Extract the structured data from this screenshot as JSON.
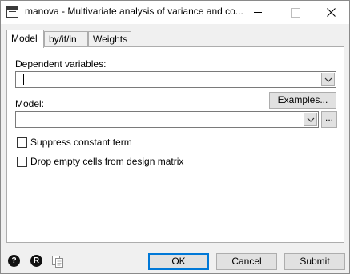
{
  "window": {
    "title": "manova - Multivariate analysis of variance and co..."
  },
  "icons": {
    "app": "dialog-icon",
    "help": "help-icon",
    "reset": "reset-icon",
    "copy": "copy-command-icon"
  },
  "tabs": [
    {
      "label": "Model",
      "active": true
    },
    {
      "label": "by/if/in",
      "active": false
    },
    {
      "label": "Weights",
      "active": false
    }
  ],
  "fields": {
    "dependent_label": "Dependent variables:",
    "dependent_value": "",
    "model_label": "Model:",
    "model_value": "",
    "examples_button": "Examples...",
    "browse_button": "..."
  },
  "options": [
    {
      "label": "Suppress constant term",
      "checked": false
    },
    {
      "label": "Drop empty cells from design matrix",
      "checked": false
    }
  ],
  "footer": {
    "ok": "OK",
    "cancel": "Cancel",
    "submit": "Submit"
  },
  "colors": {
    "focus_border": "#0078d7",
    "dialog_bg": "#f0f0f0"
  }
}
